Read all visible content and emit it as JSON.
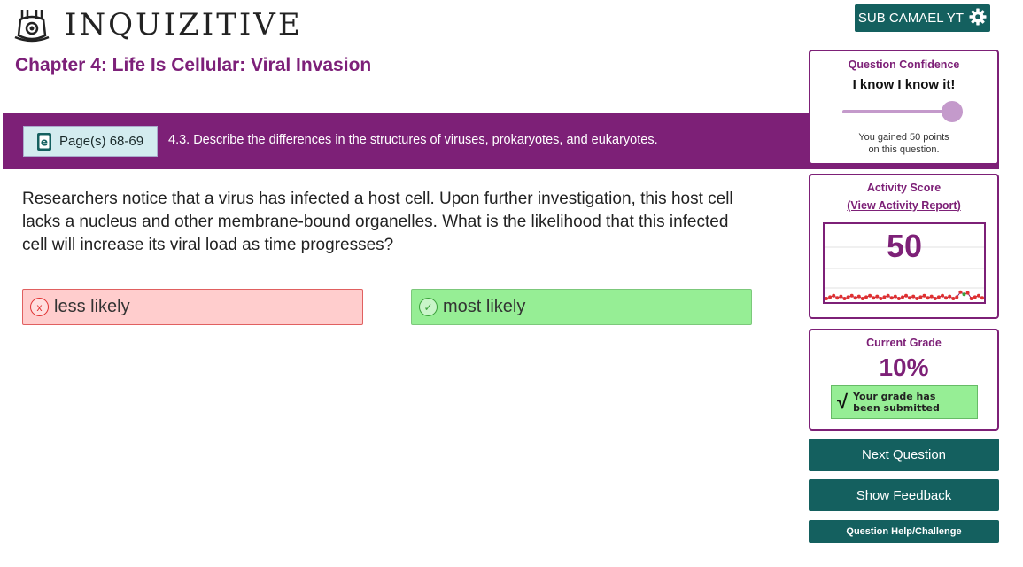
{
  "header": {
    "logo_text": "INQUIZITIVE",
    "user_label": "SUB CAMAEL YT",
    "user_icon": "gear-icon"
  },
  "chapter_title": "Chapter 4: Life Is Cellular: Viral Invasion",
  "objective_bar": {
    "page_label": "Page(s) 68-69",
    "page_icon": "ebook-icon",
    "objective": "4.3. Describe the differences in the structures of viruses, prokaryotes, and eukaryotes."
  },
  "question": "Researchers notice that a virus has infected a host cell. Upon further investigation, this host cell lacks a nucleus and other membrane-bound organelles. What is the likelihood that this infected cell will increase its viral load as time progresses?",
  "answers": [
    {
      "label": "less likely",
      "state": "incorrect",
      "icon": "x-circle-icon"
    },
    {
      "label": "most likely",
      "state": "correct",
      "icon": "check-circle-icon"
    }
  ],
  "confidence": {
    "title": "Question Confidence",
    "level": "I know I know it!",
    "slider_value": 1.0,
    "note_line1": "You gained 50 points",
    "note_line2": "on this question."
  },
  "activity": {
    "title": "Activity Score",
    "report_link": "(View Activity Report)",
    "score": "50"
  },
  "grade": {
    "title": "Current Grade",
    "value": "10%",
    "submitted_line1": "Your grade has",
    "submitted_line2": "been submitted"
  },
  "actions": {
    "next": "Next Question",
    "feedback": "Show Feedback",
    "help": "Question Help/Challenge"
  },
  "colors": {
    "brand_purple": "#7d2077",
    "action_teal": "#14605f",
    "correct_green": "#96ee95",
    "incorrect_red": "#ffcdcd"
  }
}
